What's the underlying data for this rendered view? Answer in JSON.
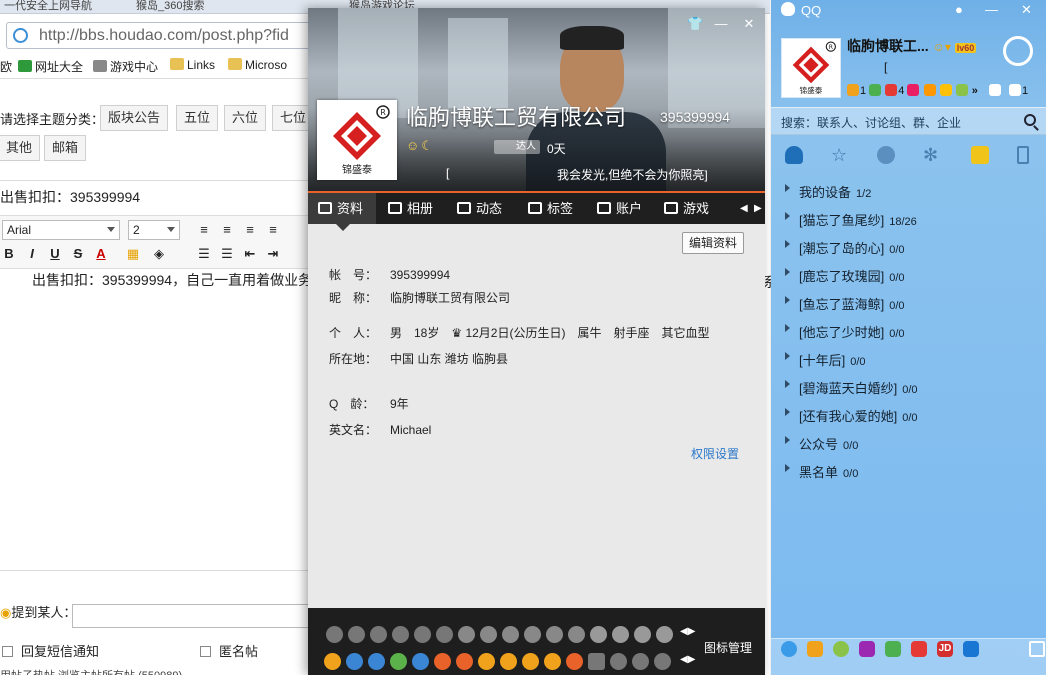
{
  "browser": {
    "tabs": [
      "一代安全上网导航",
      "猴岛_360搜索",
      "猴岛游戏论坛"
    ],
    "address_url": "http://bbs.houdao.com/post.php?fid",
    "bookmarks": [
      "网址大全",
      "游戏中心",
      "Links",
      "Microso"
    ],
    "bookmark_prefix": "欧",
    "category_label": "请选择主题分类：",
    "categories": [
      "版块公告",
      "五位",
      "六位",
      "七位",
      "其他",
      "邮箱"
    ],
    "subject": "出售扣扣：395399994",
    "font_name": "Arial",
    "font_size": "2",
    "editor_text": "出售扣扣：395399994，自己一直用着做业务",
    "right_fragment": "系",
    "mention_label": "提到某人：",
    "checkbox_sms": "回复短信通知",
    "checkbox_anon": "匿名帖",
    "bottom_text": "用帖子热帖  浏览主帖所有帖    (550989)"
  },
  "card": {
    "nickname": "临朐博联工贸有限公司",
    "qq_number": "395399994",
    "level_icons": "☺☾",
    "talent": "达人",
    "days": "0天",
    "signature_bracket": "[",
    "signature": "我会发光,但绝不会为你照亮]",
    "tabs": [
      "资料",
      "相册",
      "动态",
      "标签",
      "账户",
      "游戏"
    ],
    "edit_label": "编辑资料",
    "fields": [
      {
        "label": "帐　号：",
        "value": "395399994"
      },
      {
        "label": "昵　称：",
        "value": "临朐博联工贸有限公司"
      },
      {
        "label": "个　人：",
        "value": "男　18岁　♛ 12月2日(公历生日)　属牛　射手座　其它血型"
      },
      {
        "label": "所在地：",
        "value": "中国 山东 潍坊 临朐县"
      },
      {
        "label": "Q　龄：",
        "value": "9年"
      },
      {
        "label": "英文名：",
        "value": "Michael"
      }
    ],
    "permission_label": "权限设置",
    "icon_manager_label": "图标管理"
  },
  "qq": {
    "title": "QQ",
    "nickname": "临朐博联工...",
    "bracket": "[",
    "mini_counts": [
      "1",
      "4",
      "1"
    ],
    "vip_badge": "lv60",
    "search_placeholder": "搜索：联系人、讨论组、群、企业",
    "groups": [
      {
        "name": "我的设备",
        "count": "1/2"
      },
      {
        "name": "[猫忘了鱼尾纱]",
        "count": "18/26"
      },
      {
        "name": "[潮忘了岛的心]",
        "count": "0/0"
      },
      {
        "name": "[鹿忘了玫瑰园]",
        "count": "0/0"
      },
      {
        "name": "[鱼忘了蓝海鲸]",
        "count": "0/0"
      },
      {
        "name": "[他忘了少时她]",
        "count": "0/0"
      },
      {
        "name": "[十年后]",
        "count": "0/0"
      },
      {
        "name": "[碧海蓝天白婚纱]",
        "count": "0/0"
      },
      {
        "name": "[还有我心爱的她]",
        "count": "0/0"
      },
      {
        "name": "公众号",
        "count": "0/0"
      },
      {
        "name": "黑名单",
        "count": "0/0"
      }
    ],
    "logo_text": "锦盛泰"
  },
  "colors": {
    "qq_blue": "#7cbaf0",
    "card_accent": "#e8622a",
    "link_blue": "#2a77c9",
    "logo_red": "#d61f1f"
  }
}
